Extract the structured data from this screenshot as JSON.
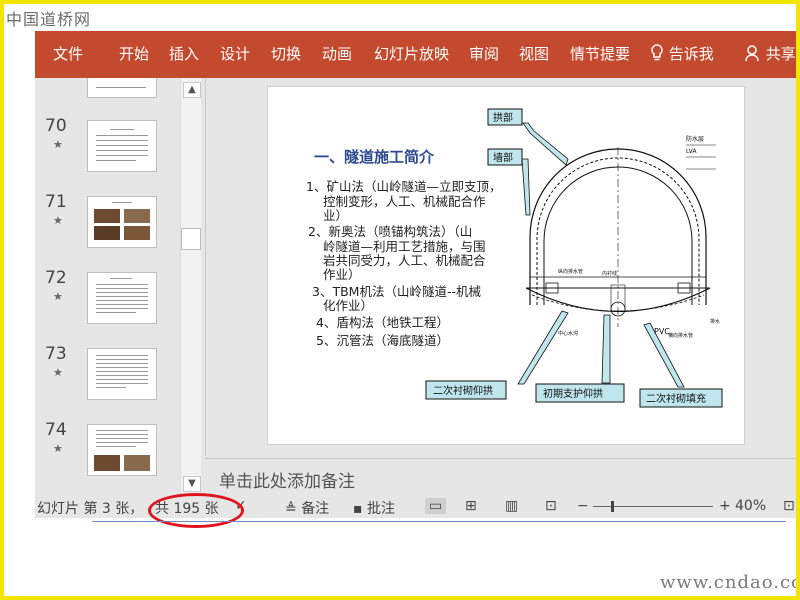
{
  "watermark_top": "中国道桥网",
  "watermark_bottom": "www.cndao.com",
  "ribbon": {
    "tabs": [
      "文件",
      "开始",
      "插入",
      "设计",
      "切换",
      "动画",
      "幻灯片放映",
      "审阅",
      "视图",
      "情节提要"
    ],
    "tell_me": "告诉我",
    "share": "共享"
  },
  "thumbnails": [
    {
      "num": "70",
      "star": "★"
    },
    {
      "num": "71",
      "star": "★"
    },
    {
      "num": "72",
      "star": "★"
    },
    {
      "num": "73",
      "star": "★"
    },
    {
      "num": "74",
      "star": "★"
    }
  ],
  "slide": {
    "title": "一、隧道施工简介",
    "items": [
      "1、矿山法（山岭隧道—立即支顶，",
      "控制变形，人工、机械配合作",
      "业）",
      "2、新奥法（喷锚构筑法）（山",
      "岭隧道—利用工艺措施，与围",
      "岩共同受力，人工、机械配合",
      "作业）",
      "3、TBM机法（山岭隧道--机械",
      "化作业）",
      "4、盾构法（地铁工程）",
      "5、沉管法（海底隧道）"
    ],
    "diagram_labels": {
      "arch": "拱部",
      "wall": "墙部",
      "inv2": "二次衬砌仰拱",
      "primary": "初期支护仰拱",
      "fill": "二次衬砌填充",
      "pvc": "PVC",
      "right_top": "防水层",
      "right_b": "LVA",
      "small1": "纵向排水管",
      "small2": "内衬线",
      "small3": "中心水沟",
      "small4": "横向排水管",
      "small5": "排水"
    }
  },
  "notes_placeholder": "单击此处添加备注",
  "status": {
    "slide_info_a": "幻灯片 第 3 张，",
    "slide_info_b": "共 195 张",
    "notes_btn": "备注",
    "comments_btn": "批注",
    "zoom": "40%"
  }
}
